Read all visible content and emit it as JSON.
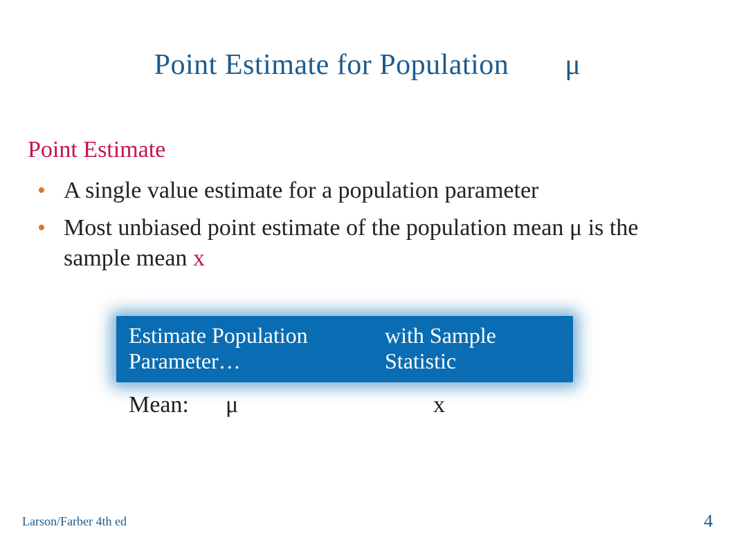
{
  "title": {
    "main": "Point Estimate for Population",
    "mu": "μ"
  },
  "subhead": "Point Estimate",
  "bullets": [
    "A single value estimate for a population parameter",
    "Most unbiased point estimate of the population mean μ is the sample mean "
  ],
  "xbar": "x",
  "table": {
    "header": {
      "col1": "Estimate Population Parameter…",
      "col2": "with Sample Statistic"
    },
    "row": {
      "label": "Mean:",
      "mu": "μ",
      "x": "x"
    }
  },
  "footer": {
    "left": "Larson/Farber 4th ed",
    "right": "4"
  }
}
